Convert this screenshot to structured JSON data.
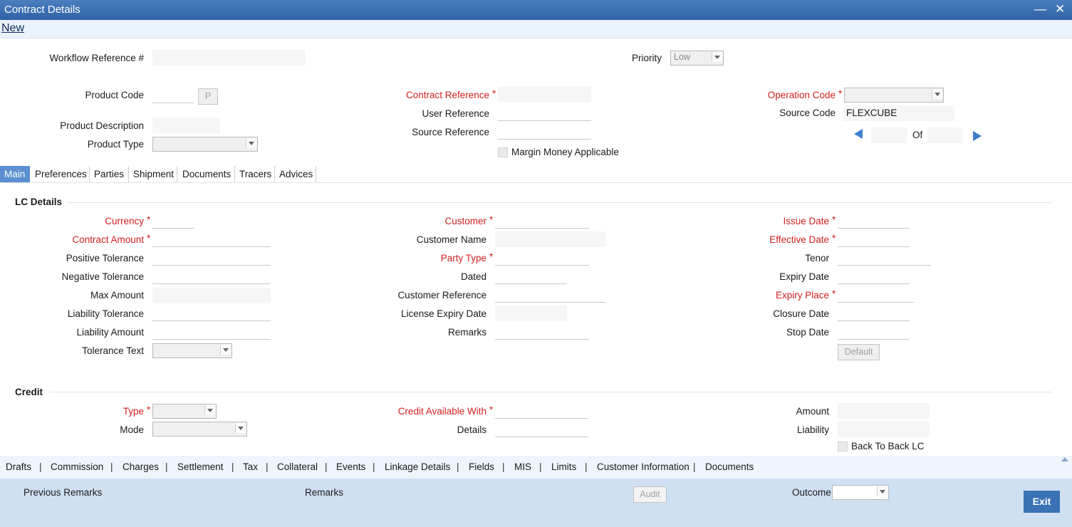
{
  "window": {
    "title": "Contract Details"
  },
  "toolbar": {
    "new_label": "New"
  },
  "header": {
    "workflow_ref_label": "Workflow Reference #",
    "priority_label": "Priority",
    "priority_value": "Low",
    "product_code_label": "Product Code",
    "product_code_btn": "P",
    "product_desc_label": "Product Description",
    "product_type_label": "Product Type",
    "contract_ref_label": "Contract Reference",
    "user_ref_label": "User Reference",
    "source_ref_label": "Source Reference",
    "margin_label": "Margin Money Applicable",
    "operation_code_label": "Operation Code",
    "source_code_label": "Source Code",
    "source_code_value": "FLEXCUBE",
    "of_label": "Of"
  },
  "tabs": [
    "Main",
    "Preferences",
    "Parties",
    "Shipment",
    "Documents",
    "Tracers",
    "Advices"
  ],
  "lc_details": {
    "title": "LC Details",
    "currency": "Currency",
    "contract_amount": "Contract Amount",
    "positive_tolerance": "Positive Tolerance",
    "negative_tolerance": "Negative Tolerance",
    "max_amount": "Max Amount",
    "liability_tolerance": "Liability Tolerance",
    "liability_amount": "Liability Amount",
    "tolerance_text": "Tolerance Text",
    "customer": "Customer",
    "customer_name": "Customer Name",
    "party_type": "Party Type",
    "dated": "Dated",
    "customer_reference": "Customer Reference",
    "license_expiry_date": "License Expiry Date",
    "remarks": "Remarks",
    "issue_date": "Issue Date",
    "effective_date": "Effective Date",
    "tenor": "Tenor",
    "expiry_date": "Expiry Date",
    "expiry_place": "Expiry Place",
    "closure_date": "Closure Date",
    "stop_date": "Stop Date",
    "default_btn": "Default"
  },
  "credit": {
    "title": "Credit",
    "type": "Type",
    "mode": "Mode",
    "available_with": "Credit Available With",
    "details": "Details",
    "amount": "Amount",
    "liability": "Liability",
    "back_to_back": "Back To Back LC"
  },
  "bottom_links": [
    "Drafts",
    "Commission",
    "Charges",
    "Settlement",
    "Tax",
    "Collateral",
    "Events",
    "Linkage Details",
    "Fields",
    "MIS",
    "Limits",
    "Customer Information",
    "Documents"
  ],
  "footer": {
    "previous_remarks": "Previous Remarks",
    "remarks": "Remarks",
    "audit_btn": "Audit",
    "outcome": "Outcome",
    "exit_btn": "Exit"
  }
}
